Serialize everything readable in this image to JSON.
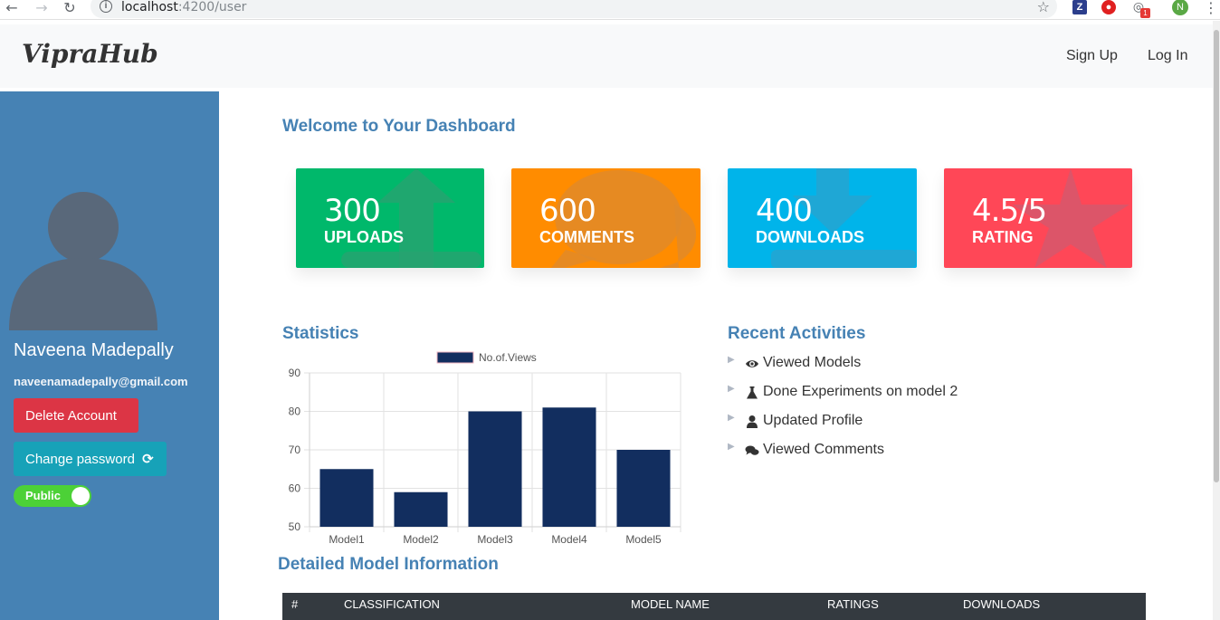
{
  "browser": {
    "url_host": "localhost",
    "url_path": ":4200/user",
    "ext_badge": "1",
    "profile_initial": "N"
  },
  "navbar": {
    "brand": "VipraHub",
    "links": [
      "Sign Up",
      "Log In"
    ]
  },
  "sidebar": {
    "name": "Naveena Madepally",
    "email": "naveenamadepally@gmail.com",
    "delete_label": "Delete Account",
    "change_password_label": "Change password",
    "visibility_label": "Public"
  },
  "main": {
    "welcome": "Welcome to Your Dashboard",
    "stats": [
      {
        "value": "300",
        "label": "UPLOADS",
        "color": "#00b86b"
      },
      {
        "value": "600",
        "label": "COMMENTS",
        "color": "#ff8c00"
      },
      {
        "value": "400",
        "label": "DOWNLOADS",
        "color": "#00b4ea"
      },
      {
        "value": "4.5/5",
        "label": "RATING",
        "color": "#ff4757"
      }
    ],
    "statistics_title": "Statistics",
    "recent_title": "Recent Activities",
    "activities": [
      {
        "icon": "eye-icon",
        "text": "Viewed Models"
      },
      {
        "icon": "flask-icon",
        "text": "Done Experiments on model 2"
      },
      {
        "icon": "user-icon",
        "text": "Updated Profile"
      },
      {
        "icon": "comments-icon",
        "text": "Viewed Comments"
      }
    ],
    "detailed_title": "Detailed Model Information",
    "table_headers": [
      "#",
      "CLASSIFICATION",
      "MODEL NAME",
      "RATINGS",
      "DOWNLOADS"
    ]
  },
  "chart_data": {
    "type": "bar",
    "categories": [
      "Model1",
      "Model2",
      "Model3",
      "Model4",
      "Model5"
    ],
    "series": [
      {
        "name": "No.of.Views",
        "values": [
          65,
          59,
          80,
          81,
          70
        ],
        "color": "#122e5f"
      }
    ],
    "ylim": [
      50,
      90
    ],
    "yticks": [
      50,
      60,
      70,
      80,
      90
    ],
    "legend": "top",
    "grid": true
  }
}
